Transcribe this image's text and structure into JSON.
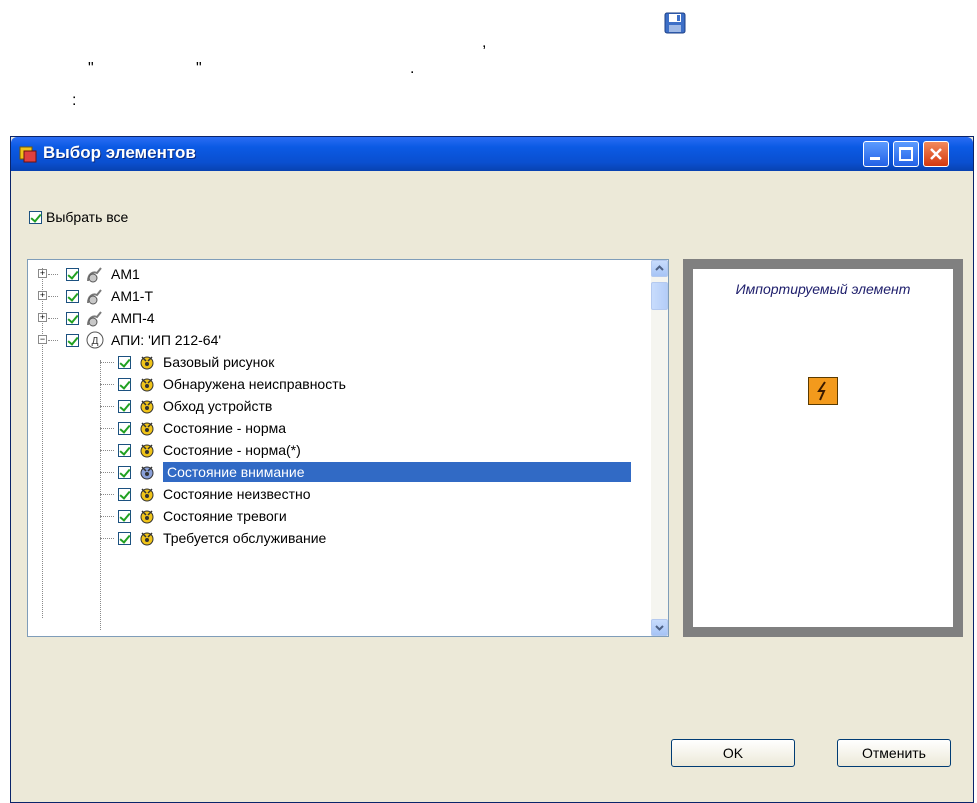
{
  "top_text": {
    "comma": ",",
    "quote_left": "\"",
    "quote_right": "\"",
    "period": ".",
    "colon": ":"
  },
  "top_icon": "save-icon",
  "dialog": {
    "title": "Выбор элементов",
    "select_all_label": "Выбрать все",
    "tree": [
      {
        "label": "АМ1",
        "expanded": false,
        "level": 0,
        "icon": "device-icon"
      },
      {
        "label": "АМ1-Т",
        "expanded": false,
        "level": 0,
        "icon": "device-icon"
      },
      {
        "label": "АМП-4",
        "expanded": false,
        "level": 0,
        "icon": "device-icon"
      },
      {
        "label": "АПИ: 'ИП 212-64'",
        "expanded": true,
        "level": 0,
        "icon": "sensor-icon"
      },
      {
        "label": "Базовый рисунок",
        "level": 1,
        "icon": "state-icon"
      },
      {
        "label": "Обнаружена неисправность",
        "level": 1,
        "icon": "state-icon"
      },
      {
        "label": "Обход устройств",
        "level": 1,
        "icon": "state-icon"
      },
      {
        "label": "Состояние - норма",
        "level": 1,
        "icon": "state-icon"
      },
      {
        "label": "Состояние - норма(*)",
        "level": 1,
        "icon": "state-icon"
      },
      {
        "label": "Состояние внимание",
        "level": 1,
        "icon": "state-icon",
        "selected": true
      },
      {
        "label": "Состояние неизвестно",
        "level": 1,
        "icon": "state-icon"
      },
      {
        "label": "Состояние тревоги",
        "level": 1,
        "icon": "state-icon"
      },
      {
        "label": "Требуется обслуживание",
        "level": 1,
        "icon": "state-icon"
      }
    ],
    "preview_caption": "Импортируемый элемент",
    "ok_label": "OK",
    "cancel_label": "Отменить"
  },
  "colors": {
    "selection": "#316ac5",
    "titlebar": "#0b5ae4",
    "preview_element": "#f39a1c",
    "dialog_bg": "#ece9d8"
  }
}
